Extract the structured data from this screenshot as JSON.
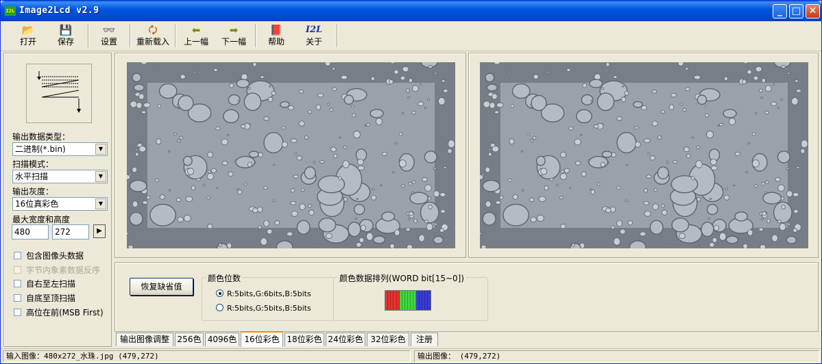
{
  "window": {
    "title": "Image2Lcd v2.9",
    "app_icon_text": "I2L"
  },
  "titlebar": {
    "minimize": "_",
    "maximize": "□",
    "close": "✕"
  },
  "toolbar": {
    "items": [
      {
        "label": "打开",
        "icon": "open-folder-icon",
        "glyph": "📂"
      },
      {
        "label": "保存",
        "icon": "floppy-disk-icon",
        "glyph": "💾"
      },
      {
        "label": "设置",
        "icon": "glasses-icon",
        "glyph": "👓"
      },
      {
        "label": "重新载入",
        "icon": "reload-icon",
        "glyph": "🗘"
      },
      {
        "label": "上一幅",
        "icon": "arrow-left-icon",
        "glyph": "⬅"
      },
      {
        "label": "下一幅",
        "icon": "arrow-right-icon",
        "glyph": "➡"
      },
      {
        "label": "帮助",
        "icon": "help-book-icon",
        "glyph": "📕"
      },
      {
        "label": "关于",
        "icon": "about-logo-icon",
        "glyph": "I2L"
      }
    ]
  },
  "left": {
    "output_type_label": "输出数据类型：",
    "output_type_value": "二进制(*.bin)",
    "scan_mode_label": "扫描模式：",
    "scan_mode_value": "水平扫描",
    "gray_label": "输出灰度：",
    "gray_value": "16位真彩色",
    "size_label": "最大宽度和高度",
    "width_value": "480",
    "height_value": "272",
    "apply_arrow": "▶",
    "options": [
      {
        "label": "包含图像头数据",
        "enabled": true
      },
      {
        "label": "字节内象素数据反序",
        "enabled": false
      },
      {
        "label": "自右至左扫描",
        "enabled": true
      },
      {
        "label": "自底至顶扫描",
        "enabled": true
      },
      {
        "label": "高位在前(MSB First)",
        "enabled": true
      }
    ]
  },
  "bottom": {
    "restore_label": "恢复缺省值",
    "color_bits_title": "颜色位数",
    "radio_565": "R:5bits,G:6bits,B:5bits",
    "radio_555": "R:5bits,G:5bits,B:5bits",
    "word_title": "颜色数据排列(WORD bit[15~0])",
    "bit_colors": {
      "red": "#e8312e",
      "green": "#3fd83f",
      "blue": "#3a3ad6"
    }
  },
  "tabs": [
    "输出图像调整",
    "256色",
    "4096色",
    "16位彩色",
    "18位彩色",
    "24位彩色",
    "32位彩色",
    "注册"
  ],
  "active_tab": "16位彩色",
  "status": {
    "input": "输入图像：480x272_水珠.jpg (479,272)",
    "output": "输出图像： (479,272)"
  }
}
